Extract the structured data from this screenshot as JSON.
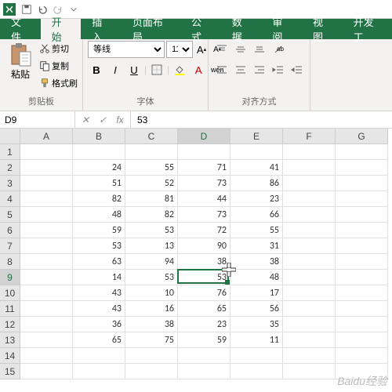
{
  "tabs": {
    "file": "文件",
    "home": "开始",
    "insert": "插入",
    "layout": "页面布局",
    "formula": "公式",
    "data": "数据",
    "review": "审阅",
    "view": "视图",
    "dev": "开发工"
  },
  "ribbon": {
    "clipboard": {
      "paste": "粘贴",
      "cut": "剪切",
      "copy": "复制",
      "format_painter": "格式刷",
      "label": "剪贴板"
    },
    "font": {
      "name": "等线",
      "size": "11",
      "label": "字体",
      "wen": "wén"
    },
    "align": {
      "label": "对齐方式"
    }
  },
  "namebox": "D9",
  "formula_value": "53",
  "fx": "fx",
  "columns": [
    "A",
    "B",
    "C",
    "D",
    "E",
    "F",
    "G"
  ],
  "row_count": 15,
  "selected": {
    "col": "D",
    "row": 9
  },
  "chart_data": {
    "type": "table",
    "columns": [
      "B",
      "C",
      "D",
      "E"
    ],
    "rows": [
      {
        "row": 2,
        "B": 24,
        "C": 55,
        "D": 71,
        "E": 41
      },
      {
        "row": 3,
        "B": 51,
        "C": 52,
        "D": 73,
        "E": 86
      },
      {
        "row": 4,
        "B": 82,
        "C": 81,
        "D": 44,
        "E": 23
      },
      {
        "row": 5,
        "B": 48,
        "C": 82,
        "D": 73,
        "E": 66
      },
      {
        "row": 6,
        "B": 59,
        "C": 53,
        "D": 72,
        "E": 55
      },
      {
        "row": 7,
        "B": 53,
        "C": 13,
        "D": 90,
        "E": 31
      },
      {
        "row": 8,
        "B": 63,
        "C": 94,
        "D": 38,
        "E": 38
      },
      {
        "row": 9,
        "B": 14,
        "C": 53,
        "D": 53,
        "E": 48
      },
      {
        "row": 10,
        "B": 43,
        "C": 10,
        "D": 76,
        "E": 17
      },
      {
        "row": 11,
        "B": 43,
        "C": 16,
        "D": 65,
        "E": 56
      },
      {
        "row": 12,
        "B": 36,
        "C": 38,
        "D": 23,
        "E": 35
      },
      {
        "row": 13,
        "B": 65,
        "C": 75,
        "D": 59,
        "E": 11
      }
    ]
  },
  "watermark": "Baidu经验"
}
